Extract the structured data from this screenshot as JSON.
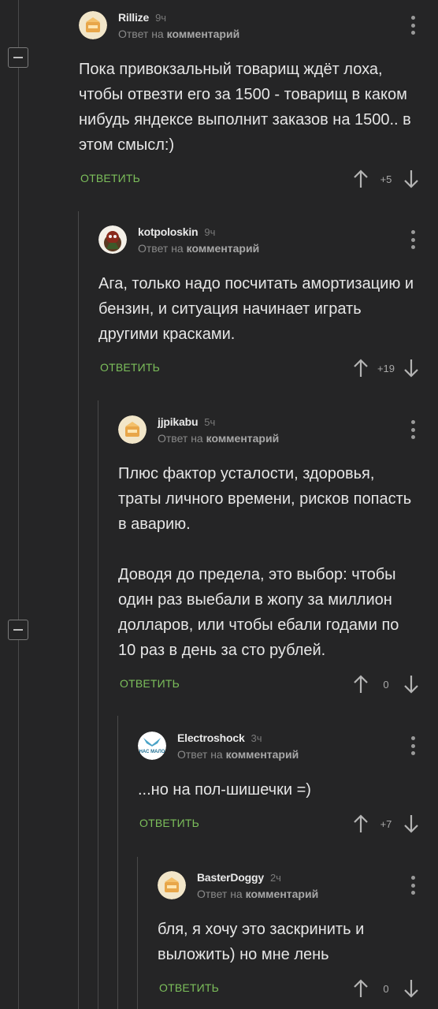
{
  "ui": {
    "reply_prefix": "Ответ на",
    "reply_target": "комментарий",
    "reply_label": "ОТВЕТИТЬ"
  },
  "comments": [
    {
      "user": "Rillize",
      "time": "9ч",
      "avatar_icon": "default-pikabu-avatar",
      "rating": "+5",
      "text": [
        "Пока привокзальный товарищ ждёт лоха, чтобы отвезти его за 1500 - товарищ в каком нибудь яндексе выполнит заказов на 1500.. в этом смысл:)"
      ]
    },
    {
      "user": "kotpoloskin",
      "time": "9ч",
      "avatar_icon": "character-avatar",
      "rating": "+19",
      "text": [
        "Ага, только надо посчитать амортизацию и бензин, и ситуация начинает играть другими красками."
      ]
    },
    {
      "user": "jjpikabu",
      "time": "5ч",
      "avatar_icon": "default-pikabu-avatar",
      "rating": "0",
      "text": [
        "Плюс фактор усталости, здоровья, траты личного времени, рисков попасть в аварию.",
        "Доводя до предела, это выбор: чтобы один раз выебали в жопу за миллион долларов, или чтобы ебали годами по 10 раз в день за сто рублей."
      ]
    },
    {
      "user": "Electroshock",
      "time": "3ч",
      "avatar_icon": "logo-avatar",
      "avatar_text": "НАС МАЛО",
      "rating": "+7",
      "text": [
        "...но на пол-шишечки =)"
      ]
    },
    {
      "user": "BasterDoggy",
      "time": "2ч",
      "avatar_icon": "default-pikabu-avatar",
      "rating": "0",
      "text": [
        "бля, я хочу это заскринить и выложить) но мне лень"
      ]
    }
  ],
  "colors": {
    "background": "#252526",
    "reply_green": "#7cbf5b",
    "avatar_bg": "#f2e6c9",
    "thread_line": "#4a4a4a"
  }
}
